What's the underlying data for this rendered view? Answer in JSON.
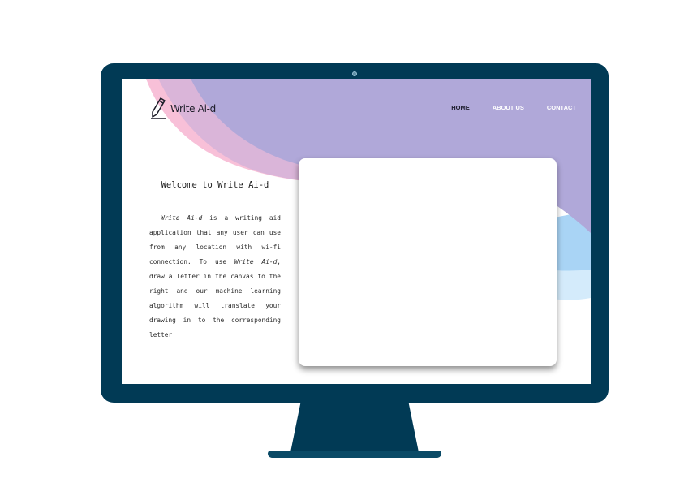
{
  "brand": {
    "name": "Write Ai-d",
    "logo_icon": "pencil-icon"
  },
  "nav": {
    "items": [
      {
        "label": "HOME",
        "active": true
      },
      {
        "label": "ABOUT US",
        "active": false
      },
      {
        "label": "CONTACT",
        "active": false
      }
    ]
  },
  "intro": {
    "heading": "Welcome to Write Ai-d",
    "p_app_name": "Write Ai-d",
    "p_text1": " is a writing aid application that any user can use from any location with wi-fi connection. To use ",
    "p_app_name2": "Write Ai-d",
    "p_text2": ", draw a letter in the canvas to the right and our machine learning algorithm will translate your drawing in to the corresponding letter."
  },
  "colors": {
    "monitor": "#013a55",
    "purple_wave": "#b0a8d9",
    "pink_wave": "#f8c0d8",
    "light_blue_wave": "#a9d4f5",
    "pale_blue_wave": "#d4ebfb"
  }
}
